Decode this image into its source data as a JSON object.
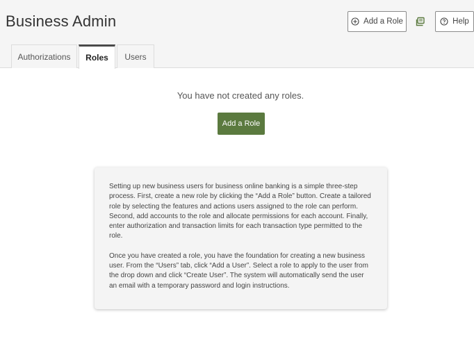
{
  "header": {
    "title": "Business Admin",
    "add_role_label": "Add a Role",
    "help_label": "Help"
  },
  "icons": {
    "add_role": "plus-circle-icon",
    "print": "print-icon",
    "help": "question-circle-icon"
  },
  "tabs": [
    {
      "label": "Authorizations",
      "active": false
    },
    {
      "label": "Roles",
      "active": true
    },
    {
      "label": "Users",
      "active": false
    }
  ],
  "main": {
    "empty_message": "You have not created any roles.",
    "add_role_button": "Add a Role"
  },
  "info": {
    "paragraph_1": "Setting up new business users for business online banking is a simple three-step process. First, create a new role by clicking the “Add a Role” button. Create a tailored role by selecting the features and actions users assigned to the role can perform. Second, add accounts to the role and allocate permissions for each account. Finally, enter authorization and transaction limits for each transaction type permitted to the role.",
    "paragraph_2": "Once you have created a role, you have the foundation for creating a new business user. From the “Users” tab, click “Add a User”. Select a role to apply to the user from the drop down and click “Create User”. The system will automatically send the user an email with a temporary password and login instructions."
  },
  "colors": {
    "primary_button": "#5b7a3f",
    "header_background": "#f5f5f5",
    "info_box_background": "#f4f4f4"
  }
}
